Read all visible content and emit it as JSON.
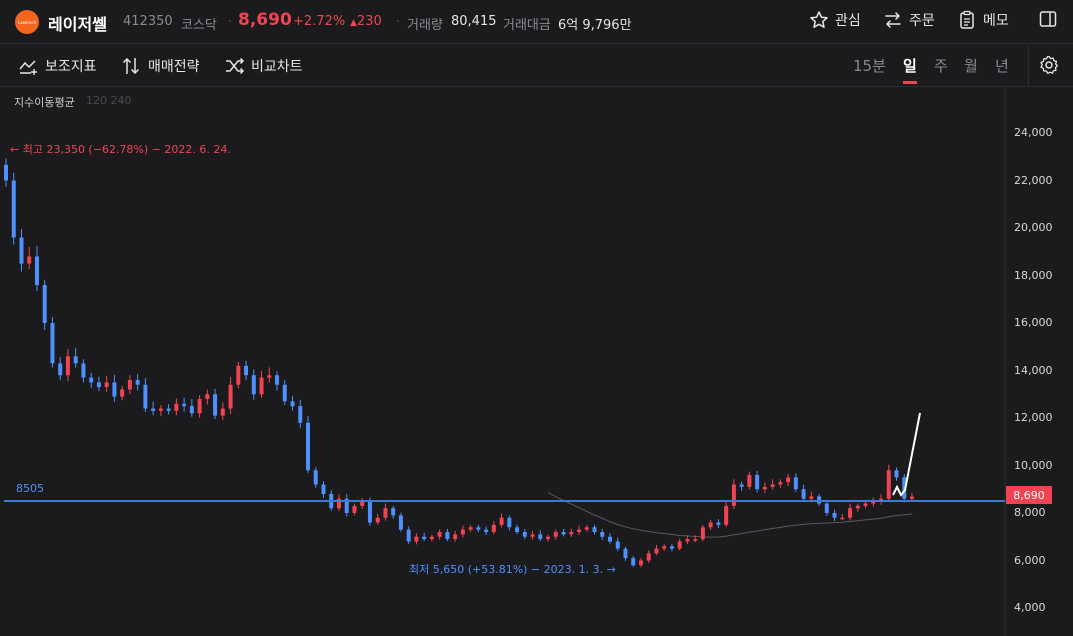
{
  "header": {
    "logo_text": "Lasercell",
    "stock_name": "레이저쎌",
    "stock_code": "412350",
    "market": "코스닥",
    "price": "8,690",
    "change_pct": "+2.72%",
    "change_val": "230",
    "volume_label": "거래량",
    "volume_value": "80,415",
    "amount_label": "거래대금",
    "amount_value": "6억 9,796만",
    "watch_label": "관심",
    "order_label": "주문",
    "memo_label": "메모"
  },
  "toolbar": {
    "indicator_label": "보조지표",
    "strategy_label": "매매전략",
    "compare_label": "비교차트",
    "periods": [
      "15분",
      "일",
      "주",
      "월",
      "년"
    ],
    "active_period": "일"
  },
  "chart_data": {
    "type": "candlestick",
    "indicator_name": "지수이동평균",
    "indicator_params": "120 240",
    "high_annotation": "← 최고 23,350 (−62.78%) − 2022. 6. 24.",
    "low_annotation": "최저 5,650 (+53.81%) − 2023. 1. 3. →",
    "reference_line_label": "8505",
    "reference_line_value": 8505,
    "current_price_label": "8,690",
    "current_price": 8690,
    "y_ticks": [
      "24,000",
      "22,000",
      "20,000",
      "18,000",
      "16,000",
      "14,000",
      "12,000",
      "10,000",
      "8,000",
      "6,000",
      "4,000"
    ],
    "y_tick_values": [
      24000,
      22000,
      20000,
      18000,
      16000,
      14000,
      12000,
      10000,
      8000,
      6000,
      4000
    ],
    "ylim": [
      4000,
      25000
    ],
    "colors": {
      "up": "#f04452",
      "down": "#4d90fe",
      "reference": "#3a7bd5",
      "ma": "#5a5a5e"
    },
    "closes": [
      22000,
      19600,
      18500,
      18800,
      17600,
      16000,
      14300,
      13800,
      14600,
      14300,
      13700,
      13500,
      13300,
      13500,
      12900,
      13200,
      13600,
      13400,
      12400,
      12300,
      12400,
      12300,
      12600,
      12500,
      12200,
      12800,
      13000,
      12100,
      12400,
      13400,
      14200,
      13800,
      13000,
      13700,
      13800,
      13400,
      12700,
      12500,
      11800,
      9800,
      9200,
      8800,
      8200,
      8600,
      8000,
      8300,
      8500,
      7600,
      7800,
      8200,
      7900,
      7300,
      6800,
      7000,
      6900,
      7000,
      7200,
      6900,
      7100,
      7300,
      7400,
      7300,
      7200,
      7500,
      7800,
      7400,
      7200,
      7000,
      7100,
      6900,
      7000,
      7200,
      7100,
      7200,
      7300,
      7400,
      7200,
      7000,
      6800,
      6500,
      6100,
      5800,
      6000,
      6300,
      6500,
      6600,
      6500,
      6800,
      6900,
      6900,
      7400,
      7600,
      7500,
      8300,
      9200,
      9100,
      9600,
      9000,
      9100,
      9200,
      9300,
      9500,
      9000,
      8600,
      8700,
      8400,
      8000,
      7800,
      7800,
      8200,
      8300,
      8400,
      8500,
      8600,
      9800,
      9500,
      8600,
      8690
    ]
  }
}
